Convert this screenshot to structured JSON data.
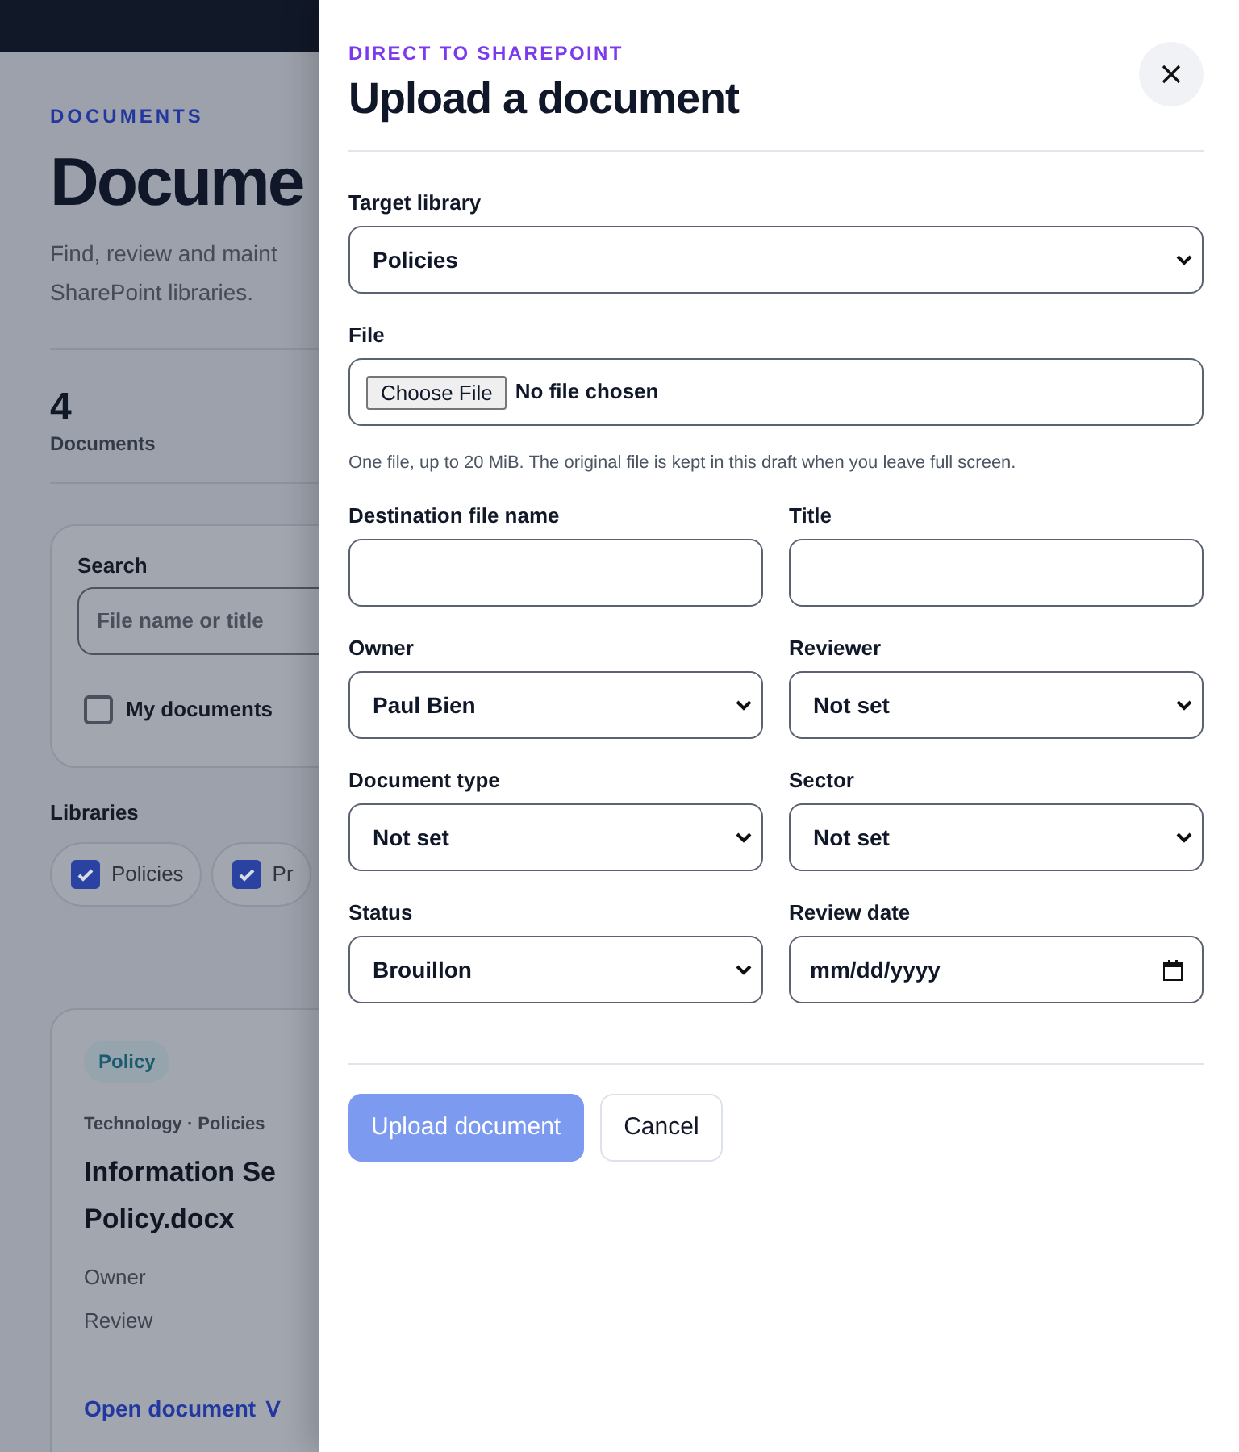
{
  "background_page": {
    "eyebrow": "DOCUMENTS",
    "title": "Docume",
    "description_lines": [
      "Find, review and maint",
      "SharePoint libraries."
    ],
    "stat": {
      "value": "4",
      "label": "Documents"
    },
    "search": {
      "label": "Search",
      "placeholder": "File name or title"
    },
    "my_documents": {
      "label": "My documents",
      "checked": false
    },
    "libraries_label": "Libraries",
    "libraries": [
      {
        "label": "Policies",
        "checked": true
      },
      {
        "label": "Pr",
        "checked": true
      }
    ],
    "card": {
      "tag": "Policy",
      "meta": "Technology · Policies",
      "title_lines": [
        "Information Se",
        "Policy.docx"
      ],
      "fields": [
        "Owner",
        "Review"
      ],
      "links": [
        "Open document",
        "V"
      ]
    }
  },
  "panel": {
    "eyebrow": "DIRECT TO SHAREPOINT",
    "title": "Upload a document",
    "rows": [
      [
        {
          "kind": "select",
          "label": "Target library",
          "value": "Policies"
        }
      ],
      [
        {
          "kind": "file",
          "label": "File",
          "button": "Choose File",
          "value": "No file chosen",
          "hint": "One file, up to 20 MiB. The original file is kept in this draft when you leave full screen."
        }
      ],
      [
        {
          "kind": "text",
          "label": "Destination file name"
        },
        {
          "kind": "text",
          "label": "Title"
        }
      ],
      [
        {
          "kind": "select",
          "label": "Owner",
          "value": "Paul Bien"
        },
        {
          "kind": "select",
          "label": "Reviewer",
          "value": "Not set"
        }
      ],
      [
        {
          "kind": "select",
          "label": "Document type",
          "value": "Not set"
        },
        {
          "kind": "select",
          "label": "Sector",
          "value": "Not set"
        }
      ],
      [
        {
          "kind": "select",
          "label": "Status",
          "value": "Brouillon"
        },
        {
          "kind": "date",
          "label": "Review date",
          "value": "mm/dd/yyyy"
        }
      ]
    ],
    "buttons": [
      {
        "label": "Upload document",
        "kind": "primary",
        "disabled": true
      },
      {
        "label": "Cancel",
        "kind": "secondary",
        "disabled": false
      }
    ]
  }
}
